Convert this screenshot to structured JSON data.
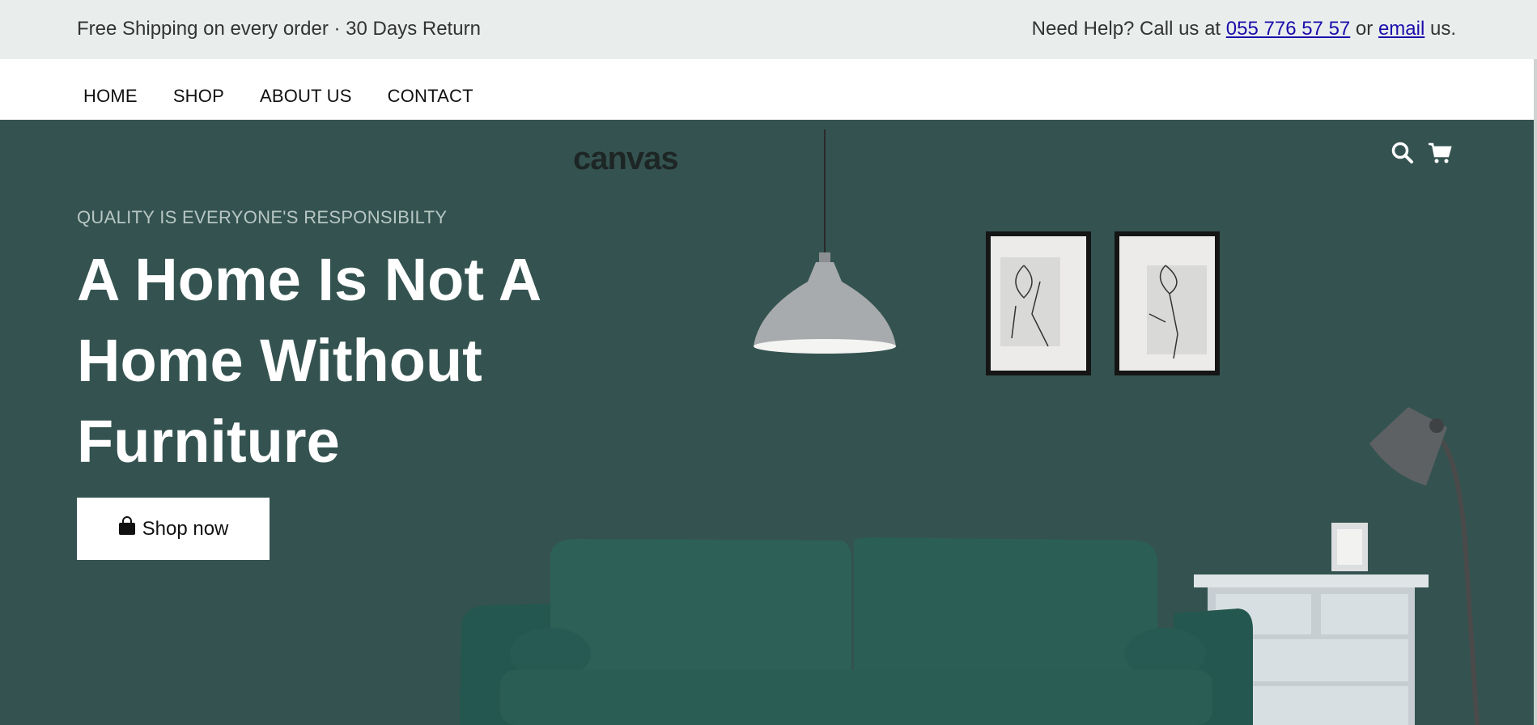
{
  "topbar": {
    "promo": "Free Shipping on every order · 30 Days Return",
    "help_prefix": "Need Help? Call us at ",
    "phone": "055 776 57 57",
    "help_or": " or ",
    "email_label": "email",
    "help_suffix": " us."
  },
  "nav": {
    "items": [
      {
        "label": "HOME"
      },
      {
        "label": "SHOP"
      },
      {
        "label": "ABOUT US"
      },
      {
        "label": "CONTACT"
      }
    ]
  },
  "hero": {
    "logo": "canvas",
    "tagline": "QUALITY IS EVERYONE'S RESPONSIBILTY",
    "headline_lines": [
      "A Home Is Not A",
      "Home Without",
      "Furniture"
    ],
    "cta_label": "Shop now",
    "icons": [
      "search-icon",
      "cart-icon",
      "shopping-bag-icon"
    ]
  },
  "colors": {
    "hero_bg": "#345350",
    "topbar_bg": "#e9eeed",
    "sofa": "#2a5a52",
    "link": "#1a0dab"
  }
}
